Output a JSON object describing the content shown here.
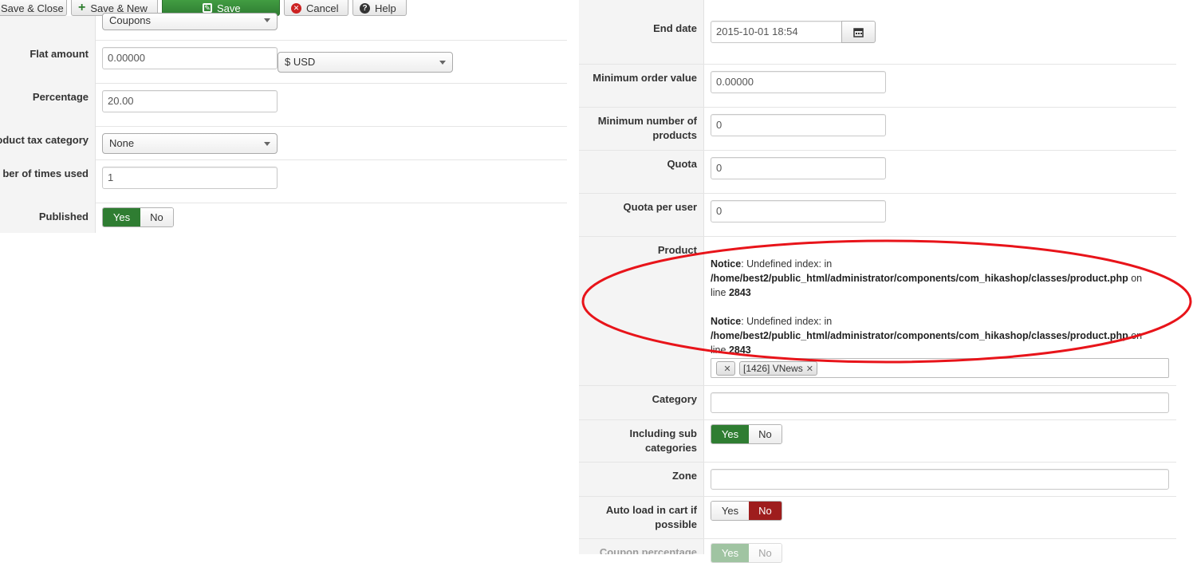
{
  "toolbar": {
    "save_close_label": "Save & Close",
    "save_new_label": "Save & New",
    "save_label": "Save",
    "cancel_label": "Cancel",
    "help_label": "Help"
  },
  "left_form": {
    "type_value": "Coupons",
    "flat_amount_label": "Flat amount",
    "flat_amount_value": "0.00000",
    "currency_value": "$ USD",
    "percentage_label": "Percentage",
    "percentage_value": "20.00",
    "tax_category_label": "oduct tax category",
    "tax_category_value": "None",
    "times_used_label": "ber of times used",
    "times_used_value": "1",
    "published_label": "Published",
    "published_yes": "Yes",
    "published_no": "No"
  },
  "right_form": {
    "end_date_label": "End date",
    "end_date_value": "2015-10-01 18:54",
    "min_order_label": "Minimum order value",
    "min_order_value": "0.00000",
    "min_products_label": "Minimum number of products",
    "min_products_value": "0",
    "quota_label": "Quota",
    "quota_value": "0",
    "quota_user_label": "Quota per user",
    "quota_user_value": "0",
    "product_label": "Product",
    "notices": [
      {
        "prefix": "Notice",
        "message": ": Undefined index: in",
        "path": "/home/best2/public_html/administrator/components/com_hikashop/classes/product.php",
        "on": " on",
        "line_word": "line ",
        "line_number": "2843"
      },
      {
        "prefix": "Notice",
        "message": ": Undefined index: in",
        "path": "/home/best2/public_html/administrator/components/com_hikashop/classes/product.php",
        "on": " on",
        "line_word": "line ",
        "line_number": "2843"
      }
    ],
    "product_tags": [
      {
        "label": ""
      },
      {
        "label": "[1426] VNews"
      }
    ],
    "category_label": "Category",
    "sub_categories_label": "Including sub categories",
    "sub_categories_yes": "Yes",
    "sub_categories_no": "No",
    "zone_label": "Zone",
    "autoload_label": "Auto load in cart if possible",
    "autoload_yes": "Yes",
    "autoload_no": "No",
    "coupon_percentage_label": "Coupon percentage",
    "coupon_percentage_yes": "Yes",
    "coupon_percentage_no": "No"
  },
  "colors": {
    "save_green": "#2f7d32",
    "no_red": "#9e1d1d",
    "annotation_red": "#e8141a",
    "label_bg": "#f4f4f4"
  }
}
